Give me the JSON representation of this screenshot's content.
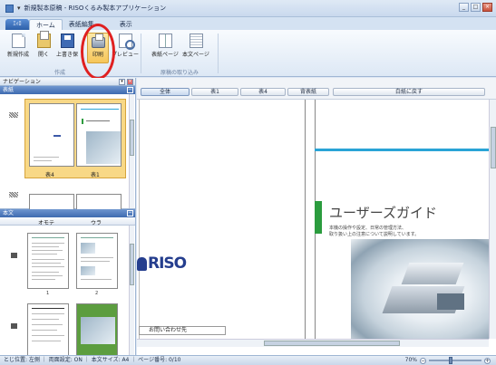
{
  "window": {
    "title": "新規製本原稿 - RISOくるみ製本アプリケーション",
    "quick_access": "▾"
  },
  "menu": {
    "orb": "ｴｨﾛ",
    "tabs": [
      "ホーム",
      "表紙編集",
      "",
      "表示"
    ],
    "active_tab": "ホーム"
  },
  "ribbon": {
    "buttons": {
      "new": "新規作成",
      "open": "開く",
      "overwrite": "上書き保",
      "print": "印刷",
      "preview": "プレビュー",
      "cover_page": "表紙ページ",
      "body_page": "本文ページ"
    },
    "groups": {
      "create": "作成",
      "import": "原稿の取り込み"
    }
  },
  "navigation": {
    "title": "ナビゲーション",
    "pin": "▾",
    "close": "×",
    "cover_section": "表紙",
    "cover_captions": [
      "表4",
      "表1"
    ],
    "body_section": "本文",
    "body_columns": [
      "オモテ",
      "ウラ"
    ],
    "page_numbers": [
      "1",
      "2"
    ]
  },
  "main": {
    "view_buttons": [
      "全体",
      "表1",
      "表4",
      "背表紙",
      "白紙に戻す"
    ],
    "active_view": "全体",
    "riso_logo": "RISO",
    "guide_title": "ユーザーズガイド",
    "guide_lines": [
      "本機の操作や設定、日常の管理方法、",
      "取り扱い上の注意について説明しています。"
    ],
    "inquiry_label": "お問い合わせ先"
  },
  "status": {
    "text": "とじ位置: 左側 ｜ 両面設定: ON ｜ 本文サイズ: A4 ｜ ページ番号: 0/10",
    "zoom": "70%",
    "zoom_level_percent": 70,
    "minus": "−",
    "plus": "+"
  },
  "colors": {
    "accent": "#3e6bb0",
    "highlight": "#f8d886",
    "annotation_circle": "#e02020",
    "guide_green": "#2b9c3e",
    "riso_blue": "#253e8e"
  }
}
